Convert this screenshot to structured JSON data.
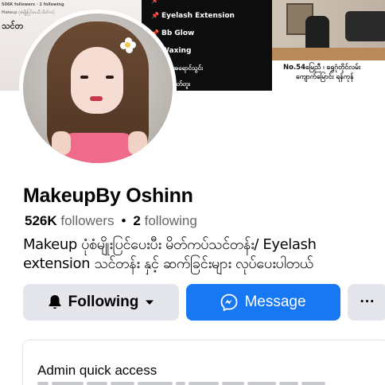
{
  "cover": {
    "left_stats": "506K followers  ·  2 following",
    "left_line": "Makeup ပုံစံမျိုးပြင်ပေးပီး မိတ်ကပ်",
    "left_script": "သင်တ",
    "service_lines": [
      "",
      "Eyelash Extension",
      "Bb Glow",
      "Waxing",
      "အမ်းအရောင်သွင်း",
      "နဖူးတတ်တူး"
    ],
    "address_line1": "No.54မြေညီ ၊ ရွှေဂုံတိုင်လမ်း",
    "address_line2": "ကျောက်မြောင်း ရန်ကုန်"
  },
  "profile": {
    "name": "MakeupBy Oshinn",
    "followers_count": "526K",
    "followers_label": "followers",
    "following_count": "2",
    "following_label": "following",
    "bio": "Makeup ပုံစံမျိုးပြင်ပေးပီး မိတ်ကပ်သင်တန်း/ Eyelash extension သင်တန်း နှင့် ဆက်ခြင်းများ လုပ်ပေးပါတယ်"
  },
  "actions": {
    "following_label": "Following",
    "message_label": "Message",
    "more_label": "···"
  },
  "admin": {
    "title": "Admin quick access"
  },
  "icons": {
    "following": "bell-icon",
    "following_caret": "caret-down-icon",
    "message": "messenger-icon",
    "more": "more-icon",
    "service_marker": "pin-icon"
  },
  "colors": {
    "primary": "#1877f2",
    "secondary_button": "#e4e6eb",
    "text_primary": "#050505",
    "text_secondary": "#65676b",
    "service_marker": "#e0245e"
  }
}
